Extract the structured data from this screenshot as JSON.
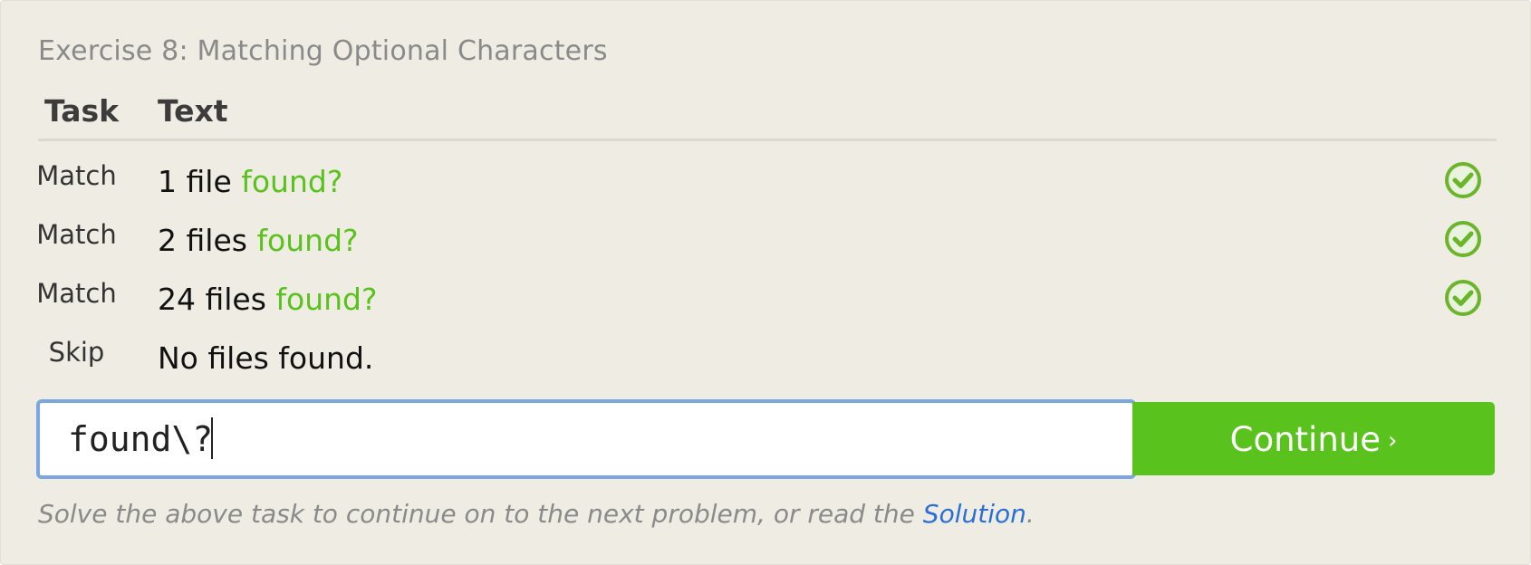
{
  "exercise": {
    "title": "Exercise 8: Matching Optional Characters"
  },
  "table": {
    "headers": {
      "task": "Task",
      "text": "Text"
    },
    "rows": [
      {
        "task": "Match",
        "text_plain": "1 file ",
        "text_match": "found?",
        "status": "check"
      },
      {
        "task": "Match",
        "text_plain": "2 files ",
        "text_match": "found?",
        "status": "check"
      },
      {
        "task": "Match",
        "text_plain": "24 files ",
        "text_match": "found?",
        "status": "check"
      },
      {
        "task": "Skip",
        "text_plain": "No files found.",
        "text_match": "",
        "status": "none"
      }
    ]
  },
  "input": {
    "value": "found\\?"
  },
  "continue_button": {
    "label": "Continue",
    "chevron": "›"
  },
  "hint": {
    "prefix": "Solve the above task to continue on to the next problem, or read the ",
    "link": "Solution",
    "suffix": "."
  },
  "colors": {
    "accent_green": "#5ac21c",
    "focus_blue": "#7ba6e1",
    "link_blue": "#2a6fd6",
    "panel_bg": "#efece4"
  },
  "icons": {
    "status_ok": "check-circle-icon"
  }
}
